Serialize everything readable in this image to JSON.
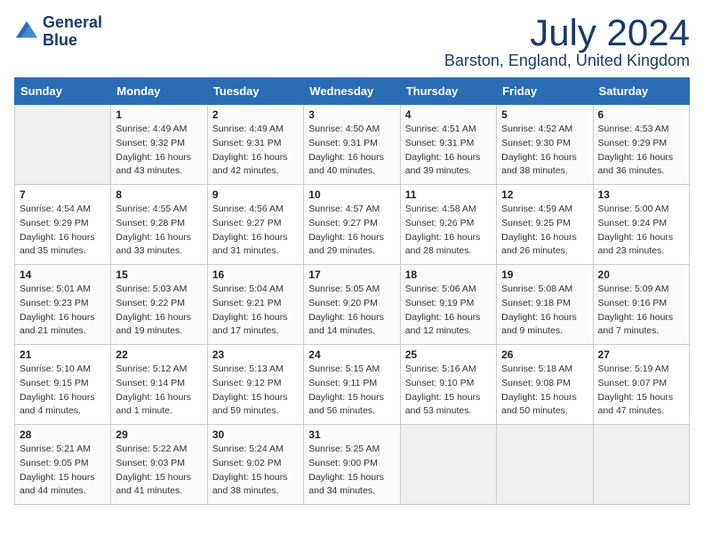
{
  "header": {
    "logo_line1": "General",
    "logo_line2": "Blue",
    "month_year": "July 2024",
    "location": "Barston, England, United Kingdom"
  },
  "days_of_week": [
    "Sunday",
    "Monday",
    "Tuesday",
    "Wednesday",
    "Thursday",
    "Friday",
    "Saturday"
  ],
  "weeks": [
    [
      {
        "day": "",
        "sunrise": "",
        "sunset": "",
        "daylight": ""
      },
      {
        "day": "1",
        "sunrise": "Sunrise: 4:49 AM",
        "sunset": "Sunset: 9:32 PM",
        "daylight": "Daylight: 16 hours and 43 minutes."
      },
      {
        "day": "2",
        "sunrise": "Sunrise: 4:49 AM",
        "sunset": "Sunset: 9:31 PM",
        "daylight": "Daylight: 16 hours and 42 minutes."
      },
      {
        "day": "3",
        "sunrise": "Sunrise: 4:50 AM",
        "sunset": "Sunset: 9:31 PM",
        "daylight": "Daylight: 16 hours and 40 minutes."
      },
      {
        "day": "4",
        "sunrise": "Sunrise: 4:51 AM",
        "sunset": "Sunset: 9:31 PM",
        "daylight": "Daylight: 16 hours and 39 minutes."
      },
      {
        "day": "5",
        "sunrise": "Sunrise: 4:52 AM",
        "sunset": "Sunset: 9:30 PM",
        "daylight": "Daylight: 16 hours and 38 minutes."
      },
      {
        "day": "6",
        "sunrise": "Sunrise: 4:53 AM",
        "sunset": "Sunset: 9:29 PM",
        "daylight": "Daylight: 16 hours and 36 minutes."
      }
    ],
    [
      {
        "day": "7",
        "sunrise": "Sunrise: 4:54 AM",
        "sunset": "Sunset: 9:29 PM",
        "daylight": "Daylight: 16 hours and 35 minutes."
      },
      {
        "day": "8",
        "sunrise": "Sunrise: 4:55 AM",
        "sunset": "Sunset: 9:28 PM",
        "daylight": "Daylight: 16 hours and 33 minutes."
      },
      {
        "day": "9",
        "sunrise": "Sunrise: 4:56 AM",
        "sunset": "Sunset: 9:27 PM",
        "daylight": "Daylight: 16 hours and 31 minutes."
      },
      {
        "day": "10",
        "sunrise": "Sunrise: 4:57 AM",
        "sunset": "Sunset: 9:27 PM",
        "daylight": "Daylight: 16 hours and 29 minutes."
      },
      {
        "day": "11",
        "sunrise": "Sunrise: 4:58 AM",
        "sunset": "Sunset: 9:26 PM",
        "daylight": "Daylight: 16 hours and 28 minutes."
      },
      {
        "day": "12",
        "sunrise": "Sunrise: 4:59 AM",
        "sunset": "Sunset: 9:25 PM",
        "daylight": "Daylight: 16 hours and 26 minutes."
      },
      {
        "day": "13",
        "sunrise": "Sunrise: 5:00 AM",
        "sunset": "Sunset: 9:24 PM",
        "daylight": "Daylight: 16 hours and 23 minutes."
      }
    ],
    [
      {
        "day": "14",
        "sunrise": "Sunrise: 5:01 AM",
        "sunset": "Sunset: 9:23 PM",
        "daylight": "Daylight: 16 hours and 21 minutes."
      },
      {
        "day": "15",
        "sunrise": "Sunrise: 5:03 AM",
        "sunset": "Sunset: 9:22 PM",
        "daylight": "Daylight: 16 hours and 19 minutes."
      },
      {
        "day": "16",
        "sunrise": "Sunrise: 5:04 AM",
        "sunset": "Sunset: 9:21 PM",
        "daylight": "Daylight: 16 hours and 17 minutes."
      },
      {
        "day": "17",
        "sunrise": "Sunrise: 5:05 AM",
        "sunset": "Sunset: 9:20 PM",
        "daylight": "Daylight: 16 hours and 14 minutes."
      },
      {
        "day": "18",
        "sunrise": "Sunrise: 5:06 AM",
        "sunset": "Sunset: 9:19 PM",
        "daylight": "Daylight: 16 hours and 12 minutes."
      },
      {
        "day": "19",
        "sunrise": "Sunrise: 5:08 AM",
        "sunset": "Sunset: 9:18 PM",
        "daylight": "Daylight: 16 hours and 9 minutes."
      },
      {
        "day": "20",
        "sunrise": "Sunrise: 5:09 AM",
        "sunset": "Sunset: 9:16 PM",
        "daylight": "Daylight: 16 hours and 7 minutes."
      }
    ],
    [
      {
        "day": "21",
        "sunrise": "Sunrise: 5:10 AM",
        "sunset": "Sunset: 9:15 PM",
        "daylight": "Daylight: 16 hours and 4 minutes."
      },
      {
        "day": "22",
        "sunrise": "Sunrise: 5:12 AM",
        "sunset": "Sunset: 9:14 PM",
        "daylight": "Daylight: 16 hours and 1 minute."
      },
      {
        "day": "23",
        "sunrise": "Sunrise: 5:13 AM",
        "sunset": "Sunset: 9:12 PM",
        "daylight": "Daylight: 15 hours and 59 minutes."
      },
      {
        "day": "24",
        "sunrise": "Sunrise: 5:15 AM",
        "sunset": "Sunset: 9:11 PM",
        "daylight": "Daylight: 15 hours and 56 minutes."
      },
      {
        "day": "25",
        "sunrise": "Sunrise: 5:16 AM",
        "sunset": "Sunset: 9:10 PM",
        "daylight": "Daylight: 15 hours and 53 minutes."
      },
      {
        "day": "26",
        "sunrise": "Sunrise: 5:18 AM",
        "sunset": "Sunset: 9:08 PM",
        "daylight": "Daylight: 15 hours and 50 minutes."
      },
      {
        "day": "27",
        "sunrise": "Sunrise: 5:19 AM",
        "sunset": "Sunset: 9:07 PM",
        "daylight": "Daylight: 15 hours and 47 minutes."
      }
    ],
    [
      {
        "day": "28",
        "sunrise": "Sunrise: 5:21 AM",
        "sunset": "Sunset: 9:05 PM",
        "daylight": "Daylight: 15 hours and 44 minutes."
      },
      {
        "day": "29",
        "sunrise": "Sunrise: 5:22 AM",
        "sunset": "Sunset: 9:03 PM",
        "daylight": "Daylight: 15 hours and 41 minutes."
      },
      {
        "day": "30",
        "sunrise": "Sunrise: 5:24 AM",
        "sunset": "Sunset: 9:02 PM",
        "daylight": "Daylight: 15 hours and 38 minutes."
      },
      {
        "day": "31",
        "sunrise": "Sunrise: 5:25 AM",
        "sunset": "Sunset: 9:00 PM",
        "daylight": "Daylight: 15 hours and 34 minutes."
      },
      {
        "day": "",
        "sunrise": "",
        "sunset": "",
        "daylight": ""
      },
      {
        "day": "",
        "sunrise": "",
        "sunset": "",
        "daylight": ""
      },
      {
        "day": "",
        "sunrise": "",
        "sunset": "",
        "daylight": ""
      }
    ]
  ]
}
